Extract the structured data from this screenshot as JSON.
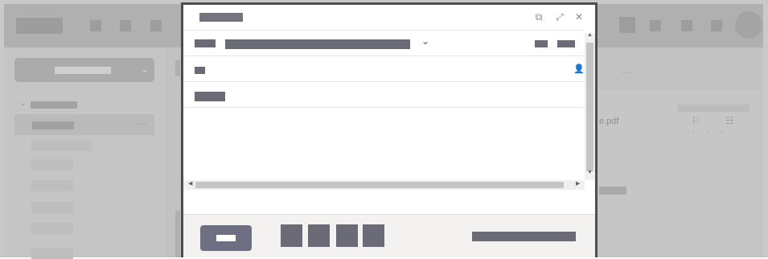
{
  "app": {
    "attachment_filename": "e.pdf",
    "more_glyph": "…",
    "more_glyph_main": "···",
    "icons": [
      "flag-icon",
      "trash-icon",
      "more-icon"
    ],
    "read_icons_glyphs": "⚐ ☷ ···",
    "new_message_chevron": "⌄",
    "folder_chevron": "⌄"
  },
  "compose": {
    "window_controls": {
      "popout": "⧉",
      "expand": "⤢",
      "close": "✕"
    },
    "from_chevron": "⌄",
    "contact_icon": "👤",
    "scroll_up": "▲",
    "scroll_down": "▼",
    "scroll_left": "◀",
    "scroll_right": "▶"
  },
  "colors": {
    "overlay_gray": "#bdbdbd",
    "dialog_border": "#4e4e4e",
    "send_button": "#6f6f84",
    "redacted_text": "#6b6b78"
  }
}
